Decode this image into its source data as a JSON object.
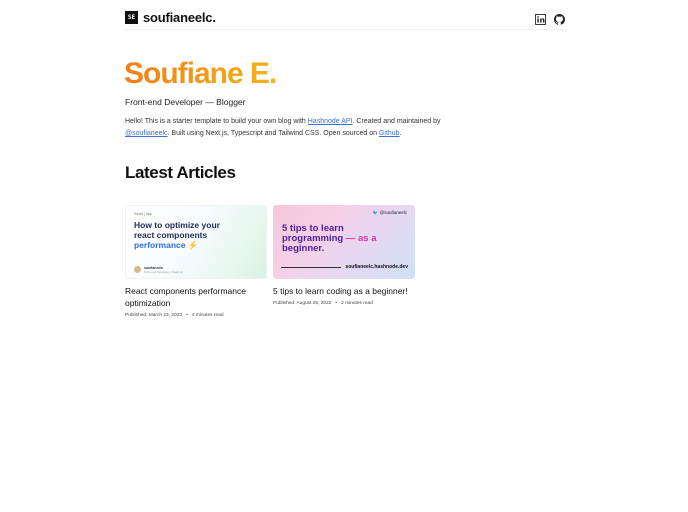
{
  "header": {
    "logo_text": "SE",
    "brand": "soufianeelc.",
    "social": [
      "linkedin-icon",
      "github-icon"
    ]
  },
  "hero": {
    "name": "Soufiane E.",
    "role": "Front-end Developer — Blogger",
    "intro": {
      "p1": "Hello! This is a starter template to build your own blog with ",
      "link1": "Hashnode API",
      "p2": ". Created and maintained by ",
      "link2": "@soufianeelc",
      "p3": ". Built using Next.js, Typescript and Tailwind CSS. Open sourced on ",
      "link3": "Github",
      "p4": "."
    }
  },
  "section": {
    "title": "Latest Articles"
  },
  "articles": [
    {
      "title": "React components performance optimization",
      "published": "Published: March 23, 2023",
      "read": "4 minutes read",
      "thumb": {
        "tag": "React | App",
        "line1": "How to optimize your",
        "line2": "react components",
        "line3": "performance",
        "emoji": "⚡",
        "author": "soufianeelc",
        "meta": "Front-end Developer | React Js"
      }
    },
    {
      "title": "5 tips to learn coding as a beginner!",
      "published": "Published: August 25, 2022",
      "read": "2 minutes read",
      "thumb": {
        "handle": "@soufianeelc",
        "line1": "5 tips to learn",
        "line2": "programming",
        "line2b": " — as a",
        "line3": "beginner.",
        "url": "soufianeelc.hashnode.dev"
      }
    }
  ],
  "colors": {
    "accent_start": "#ef7f1a",
    "accent_end": "#f5b21d",
    "link": "#3b6fd1"
  }
}
